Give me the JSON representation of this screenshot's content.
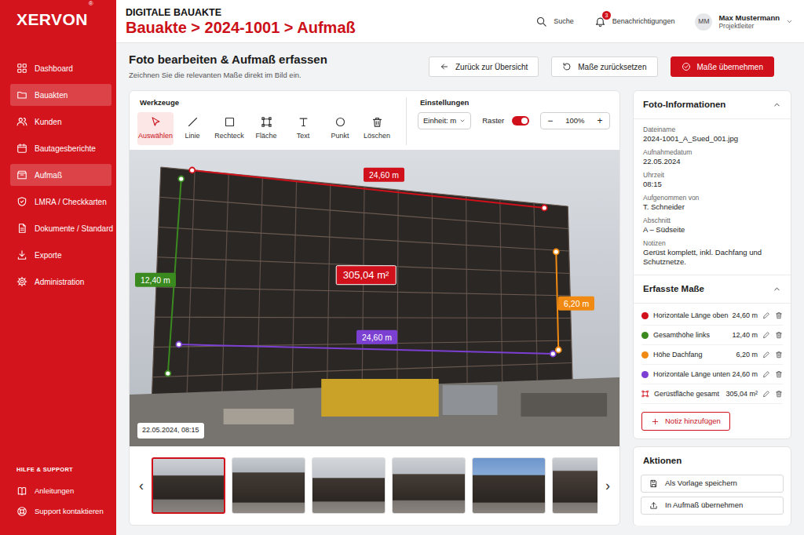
{
  "sidebar": {
    "logo": "XERVON",
    "logo_mark": "®",
    "items": [
      {
        "label": "Dashboard",
        "selected": false
      },
      {
        "label": "Bauakten",
        "selected": true
      },
      {
        "label": "Kunden",
        "selected": false
      },
      {
        "label": "Bautagesberichte",
        "selected": false
      },
      {
        "label": "Aufmaß",
        "selected": true
      },
      {
        "label": "LMRA / Checkkarten",
        "selected": false
      },
      {
        "label": "Dokumente / Standard",
        "selected": false
      },
      {
        "label": "Exporte",
        "selected": false
      },
      {
        "label": "Administration",
        "selected": false
      }
    ],
    "help_title": "HILFE & SUPPORT",
    "help_items": [
      "Anleitungen",
      "Support kontaktieren"
    ]
  },
  "header": {
    "app_title": "DIGITALE BAUAKTE",
    "breadcrumb": "Bauakte > 2024-1001 > Aufmaß",
    "search": "Suche",
    "notifications": {
      "label": "Benachrichtigungen",
      "count": "3"
    },
    "user": {
      "initials": "MM",
      "name": "Max Mustermann",
      "role": "Projektleiter"
    }
  },
  "page": {
    "title": "Foto bearbeiten & Aufmaß erfassen",
    "subtitle": "Zeichnen Sie die relevanten Maße direkt im Bild ein.",
    "buttons": [
      {
        "label": "Zurück zur Übersicht",
        "kind": "back"
      },
      {
        "label": "Maße zurücksetzen",
        "kind": "reset"
      },
      {
        "label": "Maße übernehmen",
        "kind": "primary"
      }
    ]
  },
  "tools": {
    "title": "Werkzeuge",
    "items": [
      {
        "label": "Auswählen",
        "selected": true
      },
      {
        "label": "Linie",
        "selected": false
      },
      {
        "label": "Rechteck",
        "selected": false
      },
      {
        "label": "Fläche",
        "selected": false
      },
      {
        "label": "Text",
        "selected": false
      },
      {
        "label": "Punkt",
        "selected": false
      },
      {
        "label": "Löschen",
        "selected": false
      }
    ]
  },
  "settings": {
    "title": "Einstellungen",
    "unit": "Einheit: m",
    "grid_label": "Raster",
    "grid_on": true,
    "zoom_out": "−",
    "zoom": "100%",
    "zoom_in": "+"
  },
  "photo": {
    "timestamp": "22.05.2024, 08:15",
    "annotations": [
      {
        "label": "24,60 m",
        "color": "#d0101a",
        "kind": "line"
      },
      {
        "label": "12,40 m",
        "color": "#3a8a1f",
        "kind": "line"
      },
      {
        "label": "305,04 m²",
        "color": "#d0101a",
        "kind": "area"
      },
      {
        "label": "6,20 m",
        "color": "#f08a12",
        "kind": "line"
      },
      {
        "label": "24,60 m",
        "color": "#7b3fd1",
        "kind": "line"
      }
    ]
  },
  "thumbnails": {
    "prev": "‹",
    "next": "›",
    "items": [
      {
        "selected": true
      },
      {
        "selected": false
      },
      {
        "selected": false
      },
      {
        "selected": false
      },
      {
        "selected": false
      },
      {
        "selected": false
      }
    ]
  },
  "info": {
    "title": "Foto-Informationen",
    "expanded": true,
    "fields": [
      {
        "label": "Dateiname",
        "value": "2024-1001_A_Sued_001.jpg"
      },
      {
        "label": "Aufnahmedatum",
        "value": "22.05.2024"
      },
      {
        "label": "Uhrzeit",
        "value": "08:15"
      },
      {
        "label": "Aufgenommen von",
        "value": "T. Schneider"
      },
      {
        "label": "Abschnitt",
        "value": "A – Südseite"
      },
      {
        "label": "Notizen",
        "value": "Gerüst komplett, inkl. Dachfang und Schutznetze."
      }
    ]
  },
  "measures": {
    "title": "Erfasste Maße",
    "expanded": true,
    "items": [
      {
        "label": "Horizontale Länge oben",
        "value": "24,60 m",
        "color": "#d0101a",
        "kind": "line"
      },
      {
        "label": "Gesamthöhe links",
        "value": "12,40 m",
        "color": "#3a8a1f",
        "kind": "line"
      },
      {
        "label": "Höhe Dachfang",
        "value": "6,20 m",
        "color": "#f08a12",
        "kind": "line"
      },
      {
        "label": "Horizontale Länge unten",
        "value": "24,60 m",
        "color": "#7b3fd1",
        "kind": "line"
      },
      {
        "label": "Gerüstfläche gesamt",
        "value": "305,04 m²",
        "color": "#d0101a",
        "kind": "area"
      }
    ],
    "add_note": "Notiz hinzufügen"
  },
  "actions": {
    "title": "Aktionen",
    "items": [
      "Als Vorlage speichern",
      "In Aufmaß übernehmen"
    ]
  }
}
